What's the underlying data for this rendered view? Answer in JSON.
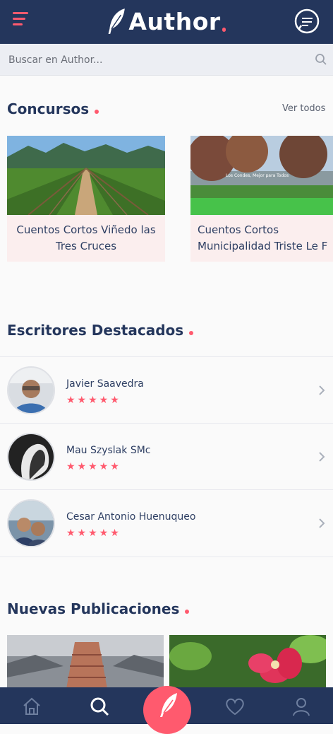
{
  "app": {
    "logo_text": "Author"
  },
  "search": {
    "placeholder": "Buscar en Author..."
  },
  "concursos": {
    "title": "Concursos",
    "see_all": "Ver todos",
    "cards": [
      {
        "caption": "Cuentos Cortos Viñedo las\nTres Cruces"
      },
      {
        "caption": "Cuentos Cortos\nMunicipalidad Triste Le F",
        "banner": "Los Condes, Mejor para Todos"
      }
    ]
  },
  "escritores": {
    "title": "Escritores Destacados",
    "items": [
      {
        "name": "Javier Saavedra",
        "stars": "★★★★★"
      },
      {
        "name": "Mau Szyslak SMc",
        "stars": "★★★★★"
      },
      {
        "name": "Cesar Antonio Huenuqueo",
        "stars": "★★★★★"
      }
    ]
  },
  "publicaciones": {
    "title": "Nuevas Publicaciones"
  },
  "nav": {
    "items": [
      "home-icon",
      "search-icon",
      "feather-icon",
      "heart-icon",
      "user-icon"
    ],
    "active": "search-icon"
  },
  "colors": {
    "navy": "#24365c",
    "accent": "#ff5a6e"
  }
}
